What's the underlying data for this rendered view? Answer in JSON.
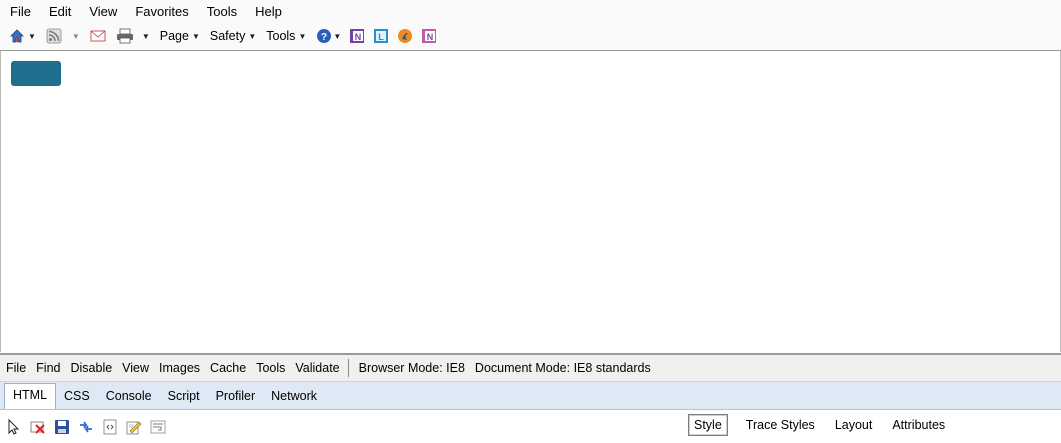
{
  "menu": [
    "File",
    "Edit",
    "View",
    "Favorites",
    "Tools",
    "Help"
  ],
  "command_bar": {
    "page_label": "Page",
    "safety_label": "Safety",
    "tools_label": "Tools",
    "icons": [
      "home-icon",
      "rss-feed-icon",
      "read-mail-icon",
      "print-icon",
      "help-icon",
      "onenote-icon",
      "lync-icon",
      "addon-orange-icon",
      "onenote-send-icon"
    ]
  },
  "devtools": {
    "menu": [
      "File",
      "Find",
      "Disable",
      "View",
      "Images",
      "Cache",
      "Tools",
      "Validate"
    ],
    "browser_mode": "Browser Mode: IE8",
    "document_mode": "Document Mode: IE8 standards",
    "tabs": [
      "HTML",
      "CSS",
      "Console",
      "Script",
      "Profiler",
      "Network"
    ],
    "tool_icons": [
      "select-element-icon",
      "clear-browser-icon",
      "save-icon",
      "refresh-icon",
      "view-source-icon",
      "edit-icon",
      "word-wrap-icon"
    ],
    "right_tabs": [
      "Style",
      "Trace Styles",
      "Layout",
      "Attributes"
    ]
  },
  "colors": {
    "content_button": "#1e6e8e",
    "tabbar_bg": "#dfe9f5"
  }
}
